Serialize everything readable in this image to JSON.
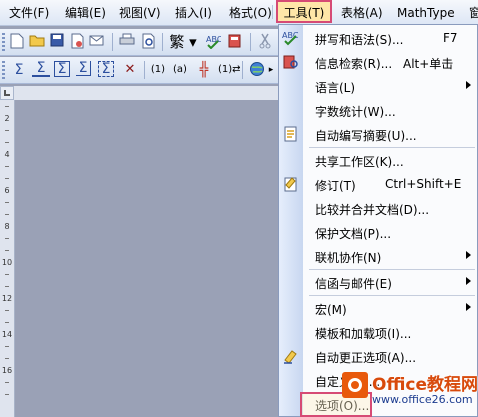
{
  "menubar": {
    "items": [
      "文件(F)",
      "编辑(E)",
      "视图(V)",
      "插入(I)",
      "格式(O)",
      "工具(T)",
      "表格(A)",
      "MathType",
      "窗"
    ],
    "active": "工具(T)"
  },
  "toolbar": {
    "traditional_label": "繁",
    "parens_1": "(1)",
    "parens_2": "(a)"
  },
  "ruler": {
    "numbers": [
      "2",
      "4",
      "6",
      "8",
      "10",
      "12",
      "14",
      "16"
    ]
  },
  "tools_menu": {
    "items": [
      {
        "label": "拼写和语法(S)...",
        "shortcut": "F7",
        "icon": "spelling-icon"
      },
      {
        "label": "信息检索(R)...",
        "shortcut": "Alt+单击",
        "icon": "research-icon"
      },
      {
        "label": "语言(L)",
        "submenu": true
      },
      {
        "label": "字数统计(W)..."
      },
      {
        "label": "自动编写摘要(U)...",
        "icon": "autosummary-icon"
      },
      {
        "label": "共享工作区(K)..."
      },
      {
        "label": "修订(T)",
        "shortcut": "Ctrl+Shift+E",
        "icon": "track-changes-icon"
      },
      {
        "label": "比较并合并文档(D)..."
      },
      {
        "label": "保护文档(P)..."
      },
      {
        "label": "联机协作(N)",
        "submenu": true
      },
      {
        "label": "信函与邮件(E)",
        "submenu": true
      },
      {
        "label": "宏(M)",
        "submenu": true
      },
      {
        "label": "模板和加载项(I)..."
      },
      {
        "label": "自动更正选项(A)...",
        "icon": "autocorrect-icon"
      },
      {
        "label": "自定义(C)..."
      },
      {
        "label": "选项(O)..."
      }
    ]
  },
  "watermark": {
    "title": "Office教程网",
    "url": "www.office26.com"
  },
  "colors": {
    "accent_border": "#d64a75",
    "menu_highlight": "#ffe6a8",
    "watermark_orange": "#e8590c",
    "watermark_blue": "#1b3b8f"
  }
}
